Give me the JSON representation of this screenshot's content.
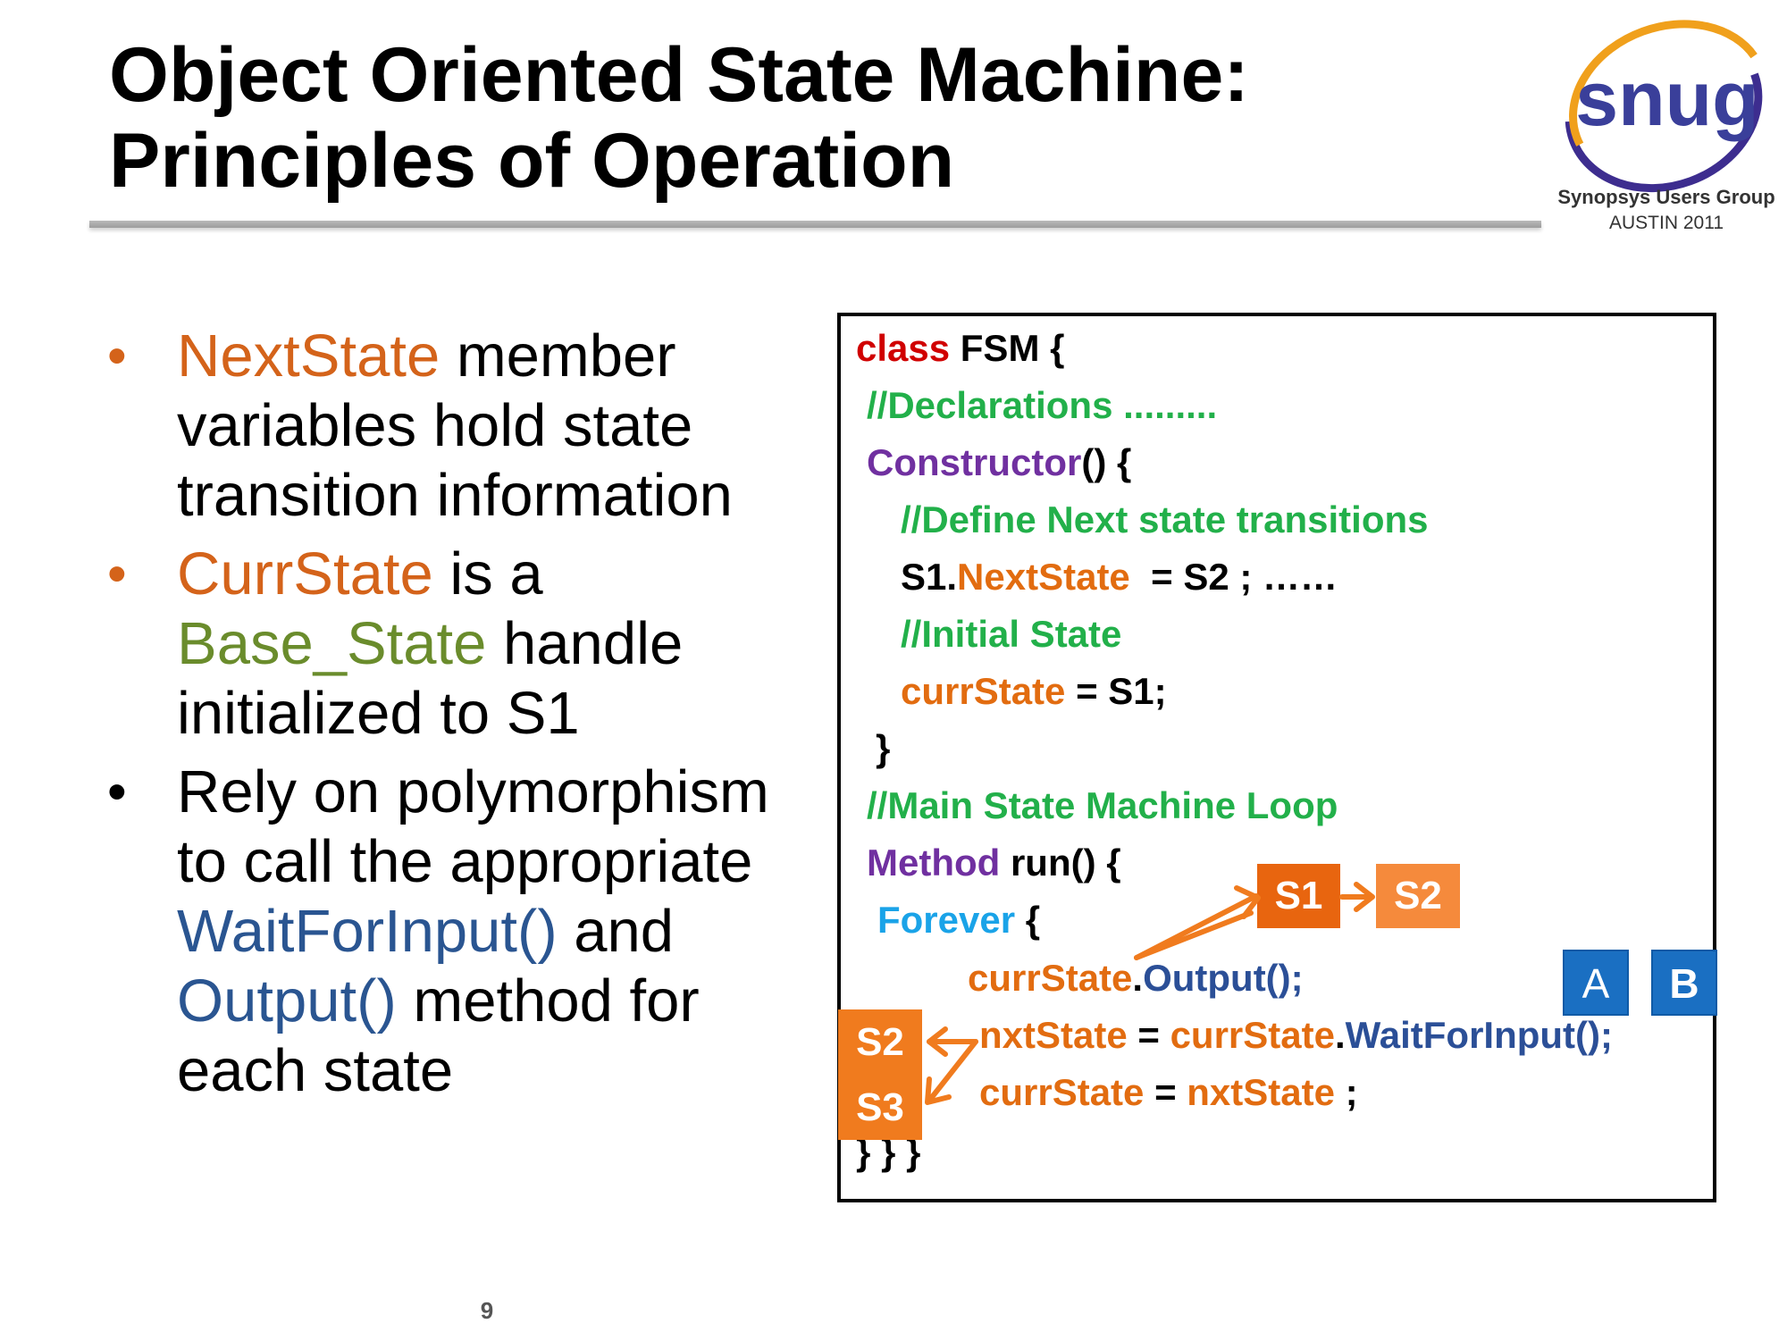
{
  "slide": {
    "title_line1": "Object Oriented State Machine:",
    "title_line2": "Principles of Operation",
    "page_number": "9"
  },
  "logo": {
    "wordmark": "snug",
    "subtitle": "Synopsys Users Group",
    "location": "AUSTIN 2011",
    "colors": {
      "ring_blue": "#3d2d8f",
      "ring_orange": "#f0a01c",
      "text_blue": "#3a3f9a"
    }
  },
  "bullets": [
    {
      "parts": [
        "NextState",
        " member variables hold state transition information"
      ]
    },
    {
      "parts": [
        "CurrState",
        " is a ",
        "Base_State",
        " handle initialized to S1"
      ]
    },
    {
      "parts": [
        "Rely on polymorphism to call the appropriate ",
        "WaitForInput()",
        " and ",
        "Output()",
        " method for each state"
      ]
    }
  ],
  "code": {
    "l1_kw": "class",
    "l1_rest": " FSM {",
    "l2": "//Declarations .........",
    "l3_kw": "Constructor",
    "l3_rest": "() {",
    "l4": "//Define Next state transitions",
    "l5_a": "S1.",
    "l5_b": "NextState",
    "l5_c": "  = S2 ; ……",
    "l6": "//Initial State",
    "l7_a": "currState",
    "l7_b": " = S1;",
    "l8": "}",
    "l9": "//Main State Machine Loop",
    "l10_kw": "Method",
    "l10_rest": " run() {",
    "l11_kw": "Forever",
    "l11_rest": " {",
    "l12_a": "currState",
    "l12_b": ".",
    "l12_c": "Output();",
    "l13_a": "nxtState",
    "l13_b": " = ",
    "l13_c": "currState",
    "l13_d": ".",
    "l13_e": "WaitForInput();",
    "l14_a": "currState",
    "l14_b": " = ",
    "l14_c": "nxtState",
    "l14_d": " ;",
    "l15": "} } }"
  },
  "annotations": {
    "s1": "S1",
    "s2": "S2",
    "s2_left": "S2",
    "s3_left": "S3",
    "a": "A",
    "b": "B",
    "colors": {
      "state_box": "#f07b1e",
      "state_box_dark": "#e8650f",
      "input_box": "#1a6fc2",
      "arrow": "#f07b1e"
    }
  }
}
